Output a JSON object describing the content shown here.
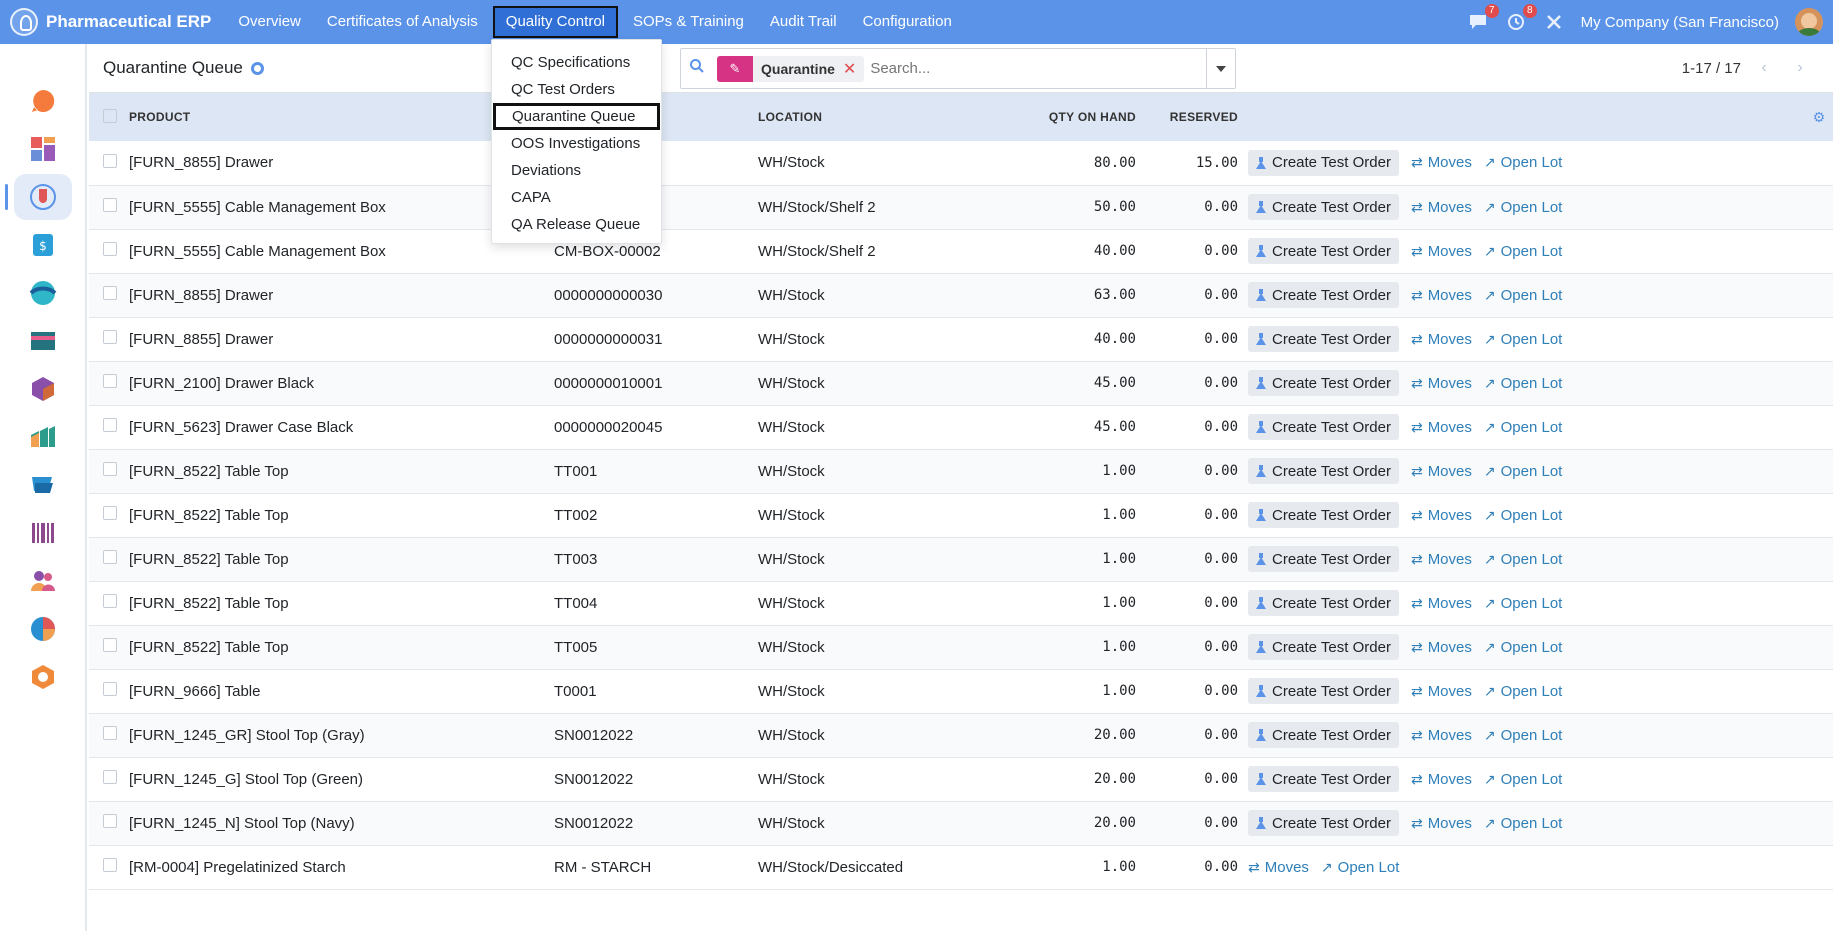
{
  "app": {
    "name": "Pharmaceutical ERP",
    "nav": [
      {
        "label": "Overview"
      },
      {
        "label": "Certificates of Analysis"
      },
      {
        "label": "Quality Control"
      },
      {
        "label": "SOPs & Training"
      },
      {
        "label": "Audit Trail"
      },
      {
        "label": "Configuration"
      }
    ],
    "active_nav": "Quality Control",
    "messages_badge": "7",
    "activities_badge": "8",
    "company": "My Company (San Francisco)"
  },
  "dropdown": {
    "items": [
      {
        "label": "QC Specifications"
      },
      {
        "label": "QC Test Orders"
      },
      {
        "label": "Quarantine Queue"
      },
      {
        "label": "OOS Investigations"
      },
      {
        "label": "Deviations"
      },
      {
        "label": "CAPA"
      },
      {
        "label": "QA Release Queue"
      }
    ],
    "active": "Quarantine Queue"
  },
  "page": {
    "title": "Quarantine Queue",
    "facet_label": "Quarantine",
    "search_placeholder": "Search...",
    "pager": "1-17 / 17"
  },
  "table": {
    "columns": {
      "product": "Product",
      "lot": "",
      "location": "Location",
      "qty": "Qty On Hand",
      "reserved": "Reserved"
    },
    "actions": {
      "create_test": "Create Test Order",
      "moves": "Moves",
      "open_lot": "Open Lot"
    },
    "rows": [
      {
        "product": "[FURN_8855] Drawer",
        "lot": "",
        "location": "WH/Stock",
        "qty": "80.00",
        "reserved": "15.00",
        "has_test": true
      },
      {
        "product": "[FURN_5555] Cable Management Box",
        "lot": "",
        "location": "WH/Stock/Shelf 2",
        "qty": "50.00",
        "reserved": "0.00",
        "has_test": true
      },
      {
        "product": "[FURN_5555] Cable Management Box",
        "lot": "CM-BOX-00002",
        "location": "WH/Stock/Shelf 2",
        "qty": "40.00",
        "reserved": "0.00",
        "has_test": true
      },
      {
        "product": "[FURN_8855] Drawer",
        "lot": "0000000000030",
        "location": "WH/Stock",
        "qty": "63.00",
        "reserved": "0.00",
        "has_test": true
      },
      {
        "product": "[FURN_8855] Drawer",
        "lot": "0000000000031",
        "location": "WH/Stock",
        "qty": "40.00",
        "reserved": "0.00",
        "has_test": true
      },
      {
        "product": "[FURN_2100] Drawer Black",
        "lot": "0000000010001",
        "location": "WH/Stock",
        "qty": "45.00",
        "reserved": "0.00",
        "has_test": true
      },
      {
        "product": "[FURN_5623] Drawer Case Black",
        "lot": "0000000020045",
        "location": "WH/Stock",
        "qty": "45.00",
        "reserved": "0.00",
        "has_test": true
      },
      {
        "product": "[FURN_8522] Table Top",
        "lot": "TT001",
        "location": "WH/Stock",
        "qty": "1.00",
        "reserved": "0.00",
        "has_test": true
      },
      {
        "product": "[FURN_8522] Table Top",
        "lot": "TT002",
        "location": "WH/Stock",
        "qty": "1.00",
        "reserved": "0.00",
        "has_test": true
      },
      {
        "product": "[FURN_8522] Table Top",
        "lot": "TT003",
        "location": "WH/Stock",
        "qty": "1.00",
        "reserved": "0.00",
        "has_test": true
      },
      {
        "product": "[FURN_8522] Table Top",
        "lot": "TT004",
        "location": "WH/Stock",
        "qty": "1.00",
        "reserved": "0.00",
        "has_test": true
      },
      {
        "product": "[FURN_8522] Table Top",
        "lot": "TT005",
        "location": "WH/Stock",
        "qty": "1.00",
        "reserved": "0.00",
        "has_test": true
      },
      {
        "product": "[FURN_9666] Table",
        "lot": "T0001",
        "location": "WH/Stock",
        "qty": "1.00",
        "reserved": "0.00",
        "has_test": true
      },
      {
        "product": "[FURN_1245_GR] Stool Top (Gray)",
        "lot": "SN0012022",
        "location": "WH/Stock",
        "qty": "20.00",
        "reserved": "0.00",
        "has_test": true
      },
      {
        "product": "[FURN_1245_G] Stool Top (Green)",
        "lot": "SN0012022",
        "location": "WH/Stock",
        "qty": "20.00",
        "reserved": "0.00",
        "has_test": true
      },
      {
        "product": "[FURN_1245_N] Stool Top (Navy)",
        "lot": "SN0012022",
        "location": "WH/Stock",
        "qty": "20.00",
        "reserved": "0.00",
        "has_test": true
      },
      {
        "product": "[RM-0004] Pregelatinized Starch",
        "lot": "RM - STARCH",
        "location": "WH/Stock/Desiccated",
        "qty": "1.00",
        "reserved": "0.00",
        "has_test": false
      }
    ]
  },
  "sidebar": {
    "apps": [
      {
        "icon": "discuss-icon",
        "color": "#f47b3b"
      },
      {
        "icon": "dashboard-icon",
        "color": "#e85c5c"
      },
      {
        "icon": "quality-app-icon",
        "color": "#e05757"
      },
      {
        "icon": "invoicing-icon",
        "color": "#2a9fd8"
      },
      {
        "icon": "crm-icon",
        "color": "#2fb6c9"
      },
      {
        "icon": "accounting-icon",
        "color": "#24737f"
      },
      {
        "icon": "inventory-icon",
        "color": "#8a4fa8"
      },
      {
        "icon": "manufacturing-icon",
        "color": "#2c9c8c"
      },
      {
        "icon": "purchase-icon",
        "color": "#2a8fd0"
      },
      {
        "icon": "barcode-icon",
        "color": "#8c4a8c"
      },
      {
        "icon": "employees-icon",
        "color": "#d85a8a"
      },
      {
        "icon": "reporting-icon",
        "color": "#e05757"
      },
      {
        "icon": "apps-icon",
        "color": "#f08a3b"
      }
    ],
    "active_index": 2
  },
  "colors": {
    "topbar": "#5b93e8",
    "header_row": "#dde6f4",
    "link": "#2f7fb8",
    "facet": "#d63384"
  }
}
